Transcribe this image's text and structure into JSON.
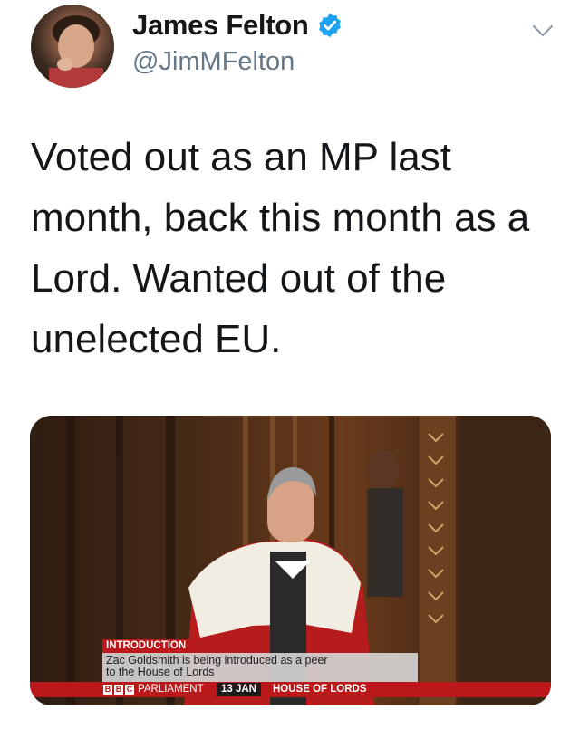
{
  "tweet": {
    "author": {
      "display_name": "James Felton",
      "handle": "@JimMFelton",
      "verified": true,
      "verified_color": "#1da1f2"
    },
    "text": "Voted out as an MP last month, back this month as a Lord. Wanted out of the unelected EU."
  },
  "media": {
    "broadcast": {
      "segment_label": "INTRODUCTION",
      "caption_line1": "Zac Goldsmith is being introduced as a peer",
      "caption_line2": "to the House of Lords",
      "logo_letters": [
        "B",
        "B",
        "C"
      ],
      "channel": "PARLIAMENT",
      "date": "13 JAN",
      "location": "HOUSE OF LORDS",
      "accent_color": "#bb1919"
    }
  }
}
